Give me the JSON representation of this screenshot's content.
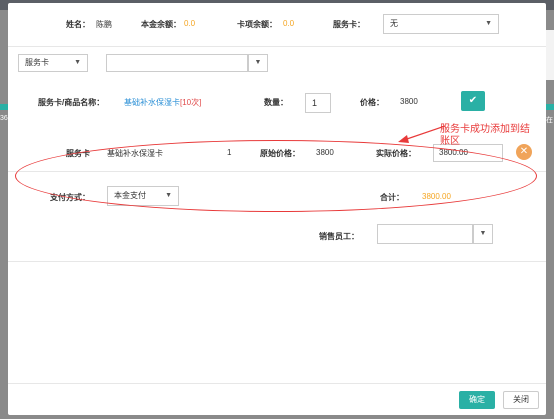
{
  "background": {
    "left_text": "36",
    "right_text": "在"
  },
  "customer": {
    "name_label": "姓名：",
    "name_value": "陈鹏",
    "principal_label": "本金余额：",
    "principal_value": "0.0",
    "card_label": "卡项余额：",
    "card_value": "0.0",
    "service_card_label": "服务卡：",
    "service_card_value": "无"
  },
  "search": {
    "type_value": "服务卡",
    "item_value": ""
  },
  "selected": {
    "name_label": "服务卡/商品名称：",
    "name_value": "基础补水保湿卡",
    "count_tag": "[10次]",
    "qty_label": "数量：",
    "qty_value": "1",
    "price_label": "价格：",
    "price_value": "3800",
    "add_icon": "check-icon"
  },
  "line_item": {
    "type": "服务卡",
    "name": "基础补水保湿卡",
    "qty": "1",
    "orig_label": "原始价格：",
    "orig_value": "3800",
    "actual_label": "实际价格：",
    "actual_value": "3800.00",
    "remove_icon": "close-icon"
  },
  "payment": {
    "label": "支付方式：",
    "value": "本金支付",
    "total_label": "合计：",
    "total_value": "3800.00"
  },
  "staff": {
    "label": "销售员工：",
    "value": ""
  },
  "annotation": {
    "text": "服务卡成功添加到结账区"
  },
  "footer": {
    "confirm": "确定",
    "close": "关闭"
  },
  "colors": {
    "teal": "#2ab0a5",
    "orange": "#f5a623",
    "annotation_red": "#e83a3a",
    "link_blue": "#2a8fd6"
  }
}
